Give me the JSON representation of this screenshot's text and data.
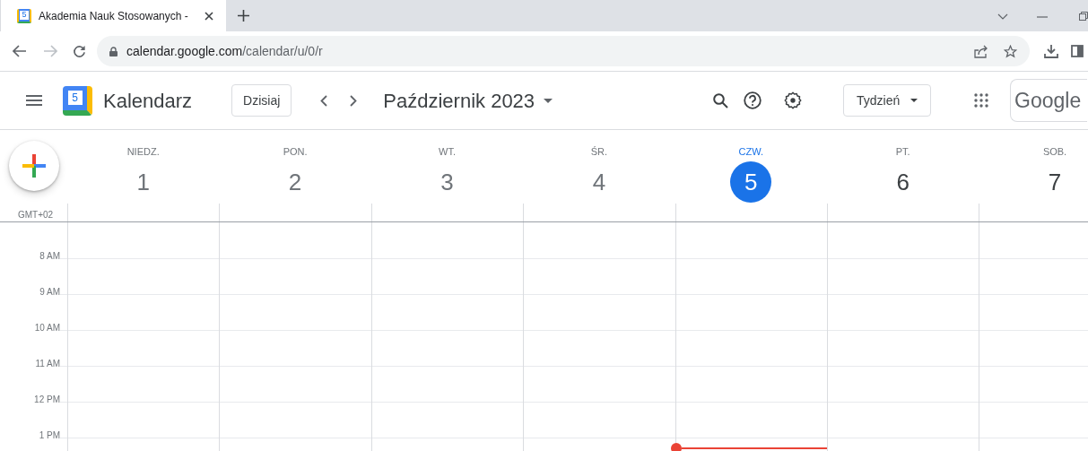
{
  "browser": {
    "tab": {
      "favicon_digit": "5",
      "title": "Akademia Nauk Stosowanych -"
    },
    "url_host": "calendar.google.com",
    "url_path": "/calendar/u/0/r"
  },
  "header": {
    "logo_digit": "5",
    "app_name": "Kalendarz",
    "today_button": "Dzisiaj",
    "period": "Październik 2023",
    "view_button": "Tydzień",
    "account_logo": "Google"
  },
  "timezone": "GMT+02",
  "days": [
    {
      "name": "NIEDZ.",
      "number": "1",
      "selected": false
    },
    {
      "name": "PON.",
      "number": "2",
      "selected": false
    },
    {
      "name": "WT.",
      "number": "3",
      "selected": false
    },
    {
      "name": "ŚR.",
      "number": "4",
      "selected": false
    },
    {
      "name": "CZW.",
      "number": "5",
      "selected": true
    },
    {
      "name": "PT.",
      "number": "6",
      "selected": false
    },
    {
      "name": "SOB.",
      "number": "7",
      "selected": false
    }
  ],
  "hours": [
    "8 AM",
    "9 AM",
    "10 AM",
    "11 AM",
    "12 PM",
    "1 PM"
  ]
}
